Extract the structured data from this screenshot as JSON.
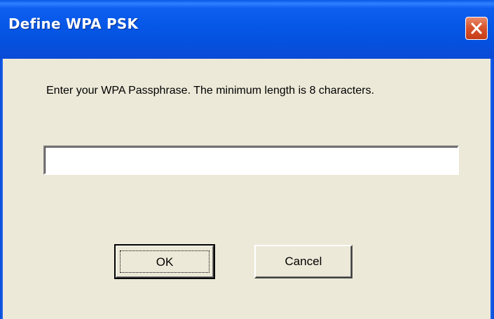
{
  "window": {
    "title": "Define WPA PSK",
    "close_glyph": "close-icon"
  },
  "dialog": {
    "prompt": "Enter your WPA Passphrase.  The minimum length is 8 characters.",
    "passphrase_value": ""
  },
  "buttons": {
    "ok_label": "OK",
    "cancel_label": "Cancel"
  },
  "colors": {
    "titlebar": "#0758e8",
    "body": "#ece9d8",
    "close": "#d9552e"
  }
}
